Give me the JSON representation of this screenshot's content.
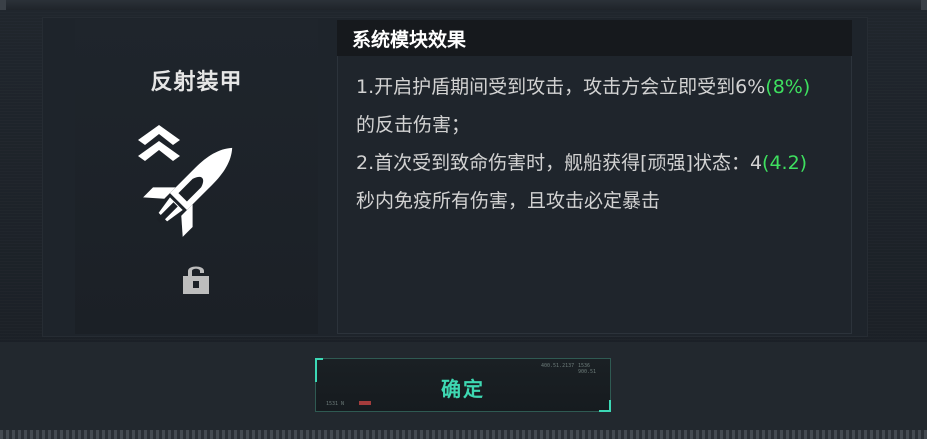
{
  "module": {
    "name": "反射装甲",
    "icons": {
      "rank": "double-chevron-up-icon",
      "module": "missile-icon",
      "lock": "lock-icon"
    }
  },
  "description": {
    "title": "系统模块效果",
    "line1_prefix": "1.开启护盾期间受到攻击，攻击方会立即受到6%",
    "line1_highlight": "(8%)",
    "line1_suffix": "的反击伤害；",
    "line2_prefix": "2.首次受到致命伤害时，舰船获得[顽强]状态：4",
    "line2_highlight": "(4.2)",
    "line2_suffix": "秒内免疫所有伤害，且攻击必定暴击"
  },
  "confirm_button": {
    "label": "确定",
    "deco_top_left": "400.51.2137",
    "deco_top_right": "1536 900.51",
    "deco_bottom": "1531 N"
  },
  "colors": {
    "highlight": "#3ee05f",
    "accent": "#3ed8b2",
    "text": "#d2d2d2"
  }
}
